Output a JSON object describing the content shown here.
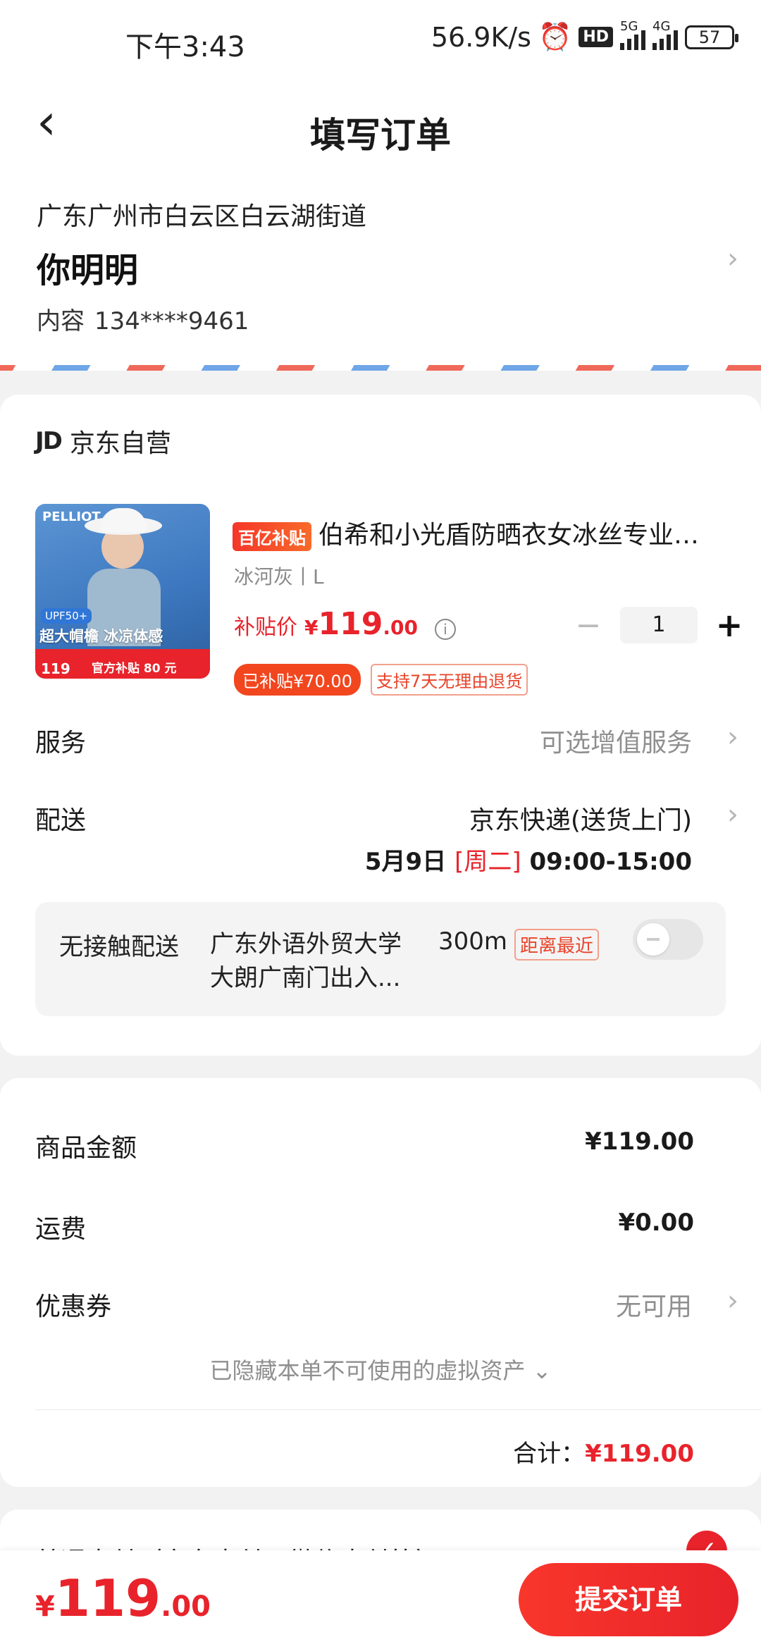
{
  "status_bar": {
    "time": "下午3:43",
    "net_speed": "56.9K/s",
    "hd": "HD",
    "signal1": "5G",
    "signal2": "4G",
    "battery": "57"
  },
  "nav": {
    "title": "填写订单"
  },
  "address": {
    "line": "广东广州市白云区白云湖街道",
    "name": "你明明",
    "phone_label": "内容",
    "phone": "134****9461"
  },
  "store": {
    "logo": "JD",
    "name": "京东自营"
  },
  "product": {
    "image_brand": "PELLIOT",
    "image_upf": "UPF50+",
    "image_slogan": "超大帽檐 冰凉体感",
    "image_price": "119",
    "image_subsidy": "官方补贴 80 元",
    "tag": "百亿补贴",
    "title": "伯希和小光盾防晒衣女冰丝专业防晒外套",
    "spec": "冰河灰丨L",
    "price_label": "补贴价",
    "price_yen": "¥",
    "price_int": "119",
    "price_dec": ".00",
    "qty": "1",
    "badge_subsidized": "已补贴¥70.00",
    "badge_return": "支持7天无理由退货"
  },
  "service": {
    "label": "服务",
    "value": "可选增值服务"
  },
  "delivery": {
    "label": "配送",
    "method": "京东快递(送货上门)",
    "date": "5月9日",
    "weekday": "[周二]",
    "time": "09:00-15:00"
  },
  "contactless": {
    "label": "无接触配送",
    "place": "广东外语外贸大学大朗广南门出入...",
    "distance": "300m",
    "tag": "距离最近",
    "enabled": false
  },
  "summary": {
    "goods_label": "商品金额",
    "goods_value": "¥119.00",
    "shipping_label": "运费",
    "shipping_value": "¥0.00",
    "coupon_label": "优惠券",
    "coupon_value": "无可用",
    "hidden_assets": "已隐藏本单不可使用的虚拟资产 ⌄",
    "total_label": "合计：",
    "total_value": "¥119.00"
  },
  "payment": {
    "label": "普通支付（京东支付、微信支付等）"
  },
  "bottom": {
    "yen": "¥",
    "int": "119",
    "dec": ".00",
    "submit": "提交订单"
  },
  "colors": {
    "accent": "#e8232b",
    "background": "#f2f2f2"
  }
}
